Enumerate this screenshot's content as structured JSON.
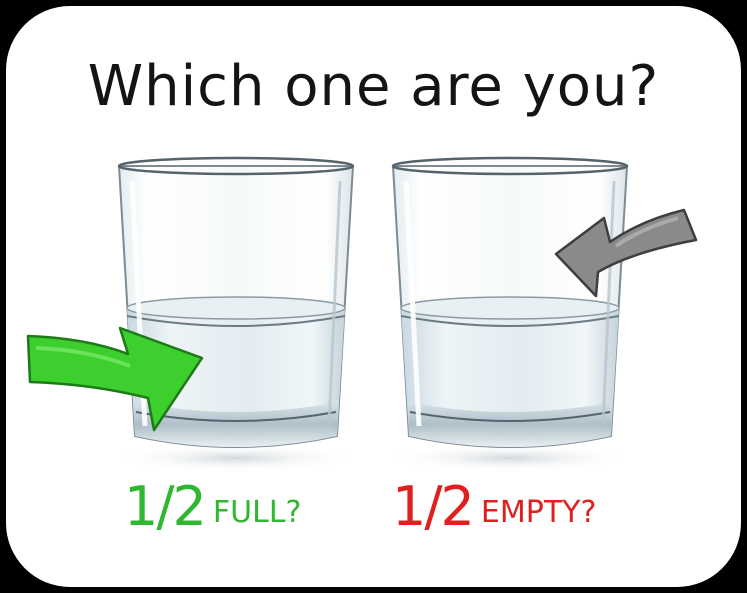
{
  "title": "Which one are you?",
  "captions": {
    "full": {
      "fraction": "1/2",
      "word": "FULL?"
    },
    "empty": {
      "fraction": "1/2",
      "word": "EMPTY?"
    }
  },
  "colors": {
    "full_text": "#2fb72f",
    "empty_text": "#e0201e",
    "full_arrow": "#3ccf2d",
    "empty_arrow": "#8a8a8a",
    "water": "#dfe9ee",
    "glass_edge": "#5c6a72"
  },
  "icons": [
    "glass-icon",
    "arrow-right-icon",
    "arrow-left-icon"
  ]
}
